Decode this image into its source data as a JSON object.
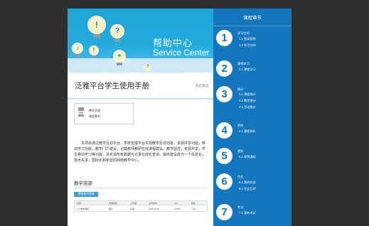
{
  "banner": {
    "title_cn": "帮助中心",
    "title_en": "Service Center",
    "bulb_symbols": [
      "!",
      "?",
      "♪",
      "!",
      "+",
      "?"
    ]
  },
  "doc": {
    "title": "泛雅平台学生使用手册",
    "brand": "超星集团",
    "toc": [
      "教学资源",
      "课程章节"
    ],
    "intro": "本项目通过教学互动平台，学校管理平台实现教学互动功能，资源共享功能，移动学习功能，教学门户建设，记载教师教研在线课程建设、教学监控，资源共享，学生移动学习等功能，并实现所有数据与记录在线化查询，最终建设成为一个信息化，技术先进，国际化和新型的网络教学中心。",
    "section_title": "教学资源",
    "table_button": "课程章节资源",
    "table_headers": [
      "名称",
      "资源类型",
      "上传者",
      "上传时间",
      "大小",
      "操作"
    ],
    "table_row": [
      "1.1 教学课程",
      "图片",
      "赵涵",
      "2015.05.19",
      "0.85M",
      "下载"
    ]
  },
  "panel": {
    "title": "课程章节",
    "chapters": [
      {
        "num": "1",
        "title": "学习空间",
        "items": [
          "1.1  登录系统",
          "1.2  学习空间"
        ]
      },
      {
        "num": "2",
        "title": "课程学习",
        "items": [
          "2.1  课程学习"
        ]
      },
      {
        "num": "3",
        "title": "统计",
        "items": [
          "3.1  课程统计",
          "3.2  教学统计",
          "3.3  活动统计"
        ]
      },
      {
        "num": "4",
        "title": "资料",
        "items": [
          "4.1  课程资料"
        ]
      },
      {
        "num": "5",
        "title": "通知",
        "items": [
          "5.1  收到通知"
        ]
      },
      {
        "num": "6",
        "title": "作业",
        "items": [
          "6.1  我的作业",
          "6.2  作业互评"
        ]
      },
      {
        "num": "7",
        "title": "考试",
        "items": [
          "7.1  我的考试"
        ]
      }
    ]
  }
}
